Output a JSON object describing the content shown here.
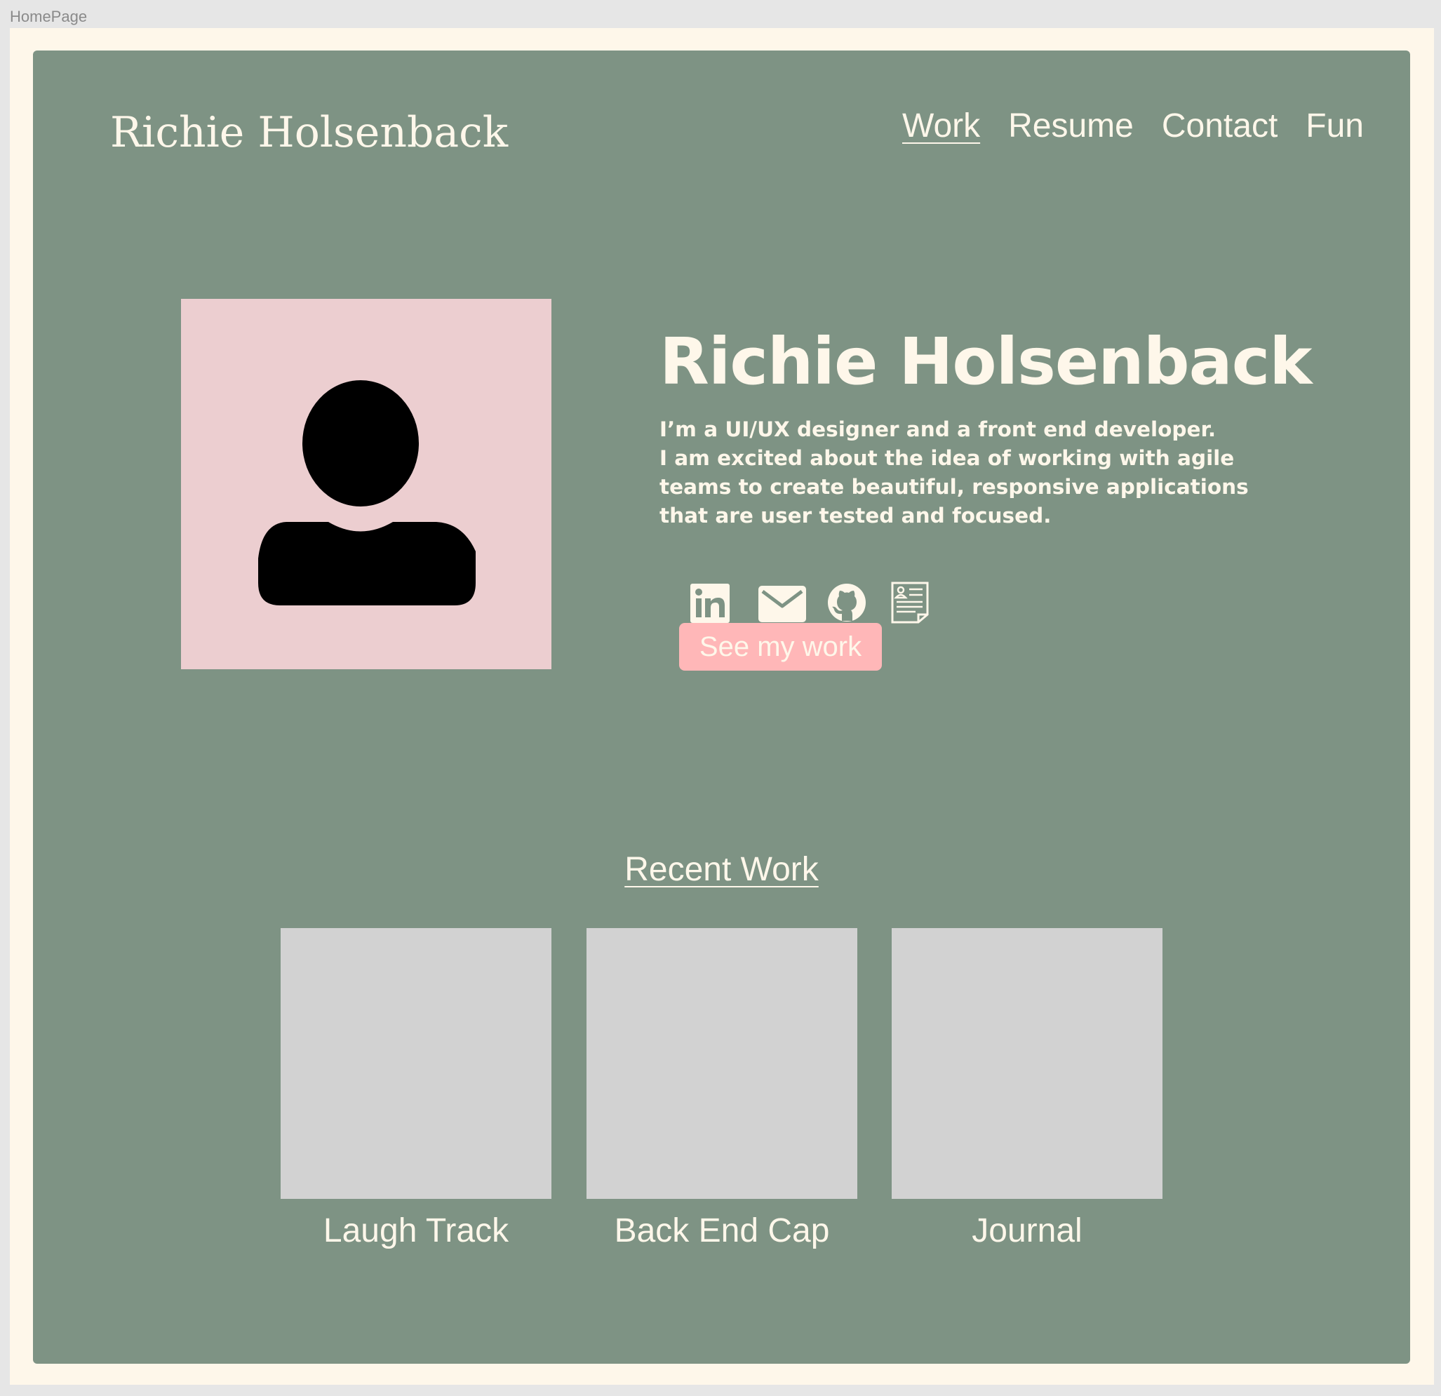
{
  "frame": {
    "label": "HomePage"
  },
  "header": {
    "logo": "Richie Holsenback",
    "nav": [
      {
        "label": "Work",
        "active": true
      },
      {
        "label": "Resume",
        "active": false
      },
      {
        "label": "Contact",
        "active": false
      },
      {
        "label": "Fun",
        "active": false
      }
    ]
  },
  "hero": {
    "title": "Richie Holsenback",
    "bio_lines": [
      "I’m a UI/UX designer and a front end developer.",
      "I am excited about the idea of working with agile",
      "teams to create beautiful, responsive applications",
      "that are user tested and focused."
    ],
    "socials": [
      {
        "icon": "linkedin-icon"
      },
      {
        "icon": "email-icon"
      },
      {
        "icon": "github-icon"
      },
      {
        "icon": "resume-document-icon"
      }
    ],
    "cta_label": "See my work"
  },
  "recent_work": {
    "heading": "Recent Work",
    "projects": [
      {
        "title": "Laugh Track"
      },
      {
        "title": "Back End Cap"
      },
      {
        "title": "Journal"
      }
    ]
  },
  "colors": {
    "page_background": "#7e9384",
    "artboard_background": "#fef7ea",
    "text": "#fef7ea",
    "avatar_background": "#ecced0",
    "cta_background": "#ffb7b8",
    "thumbnail_placeholder": "#d2d2d2"
  }
}
